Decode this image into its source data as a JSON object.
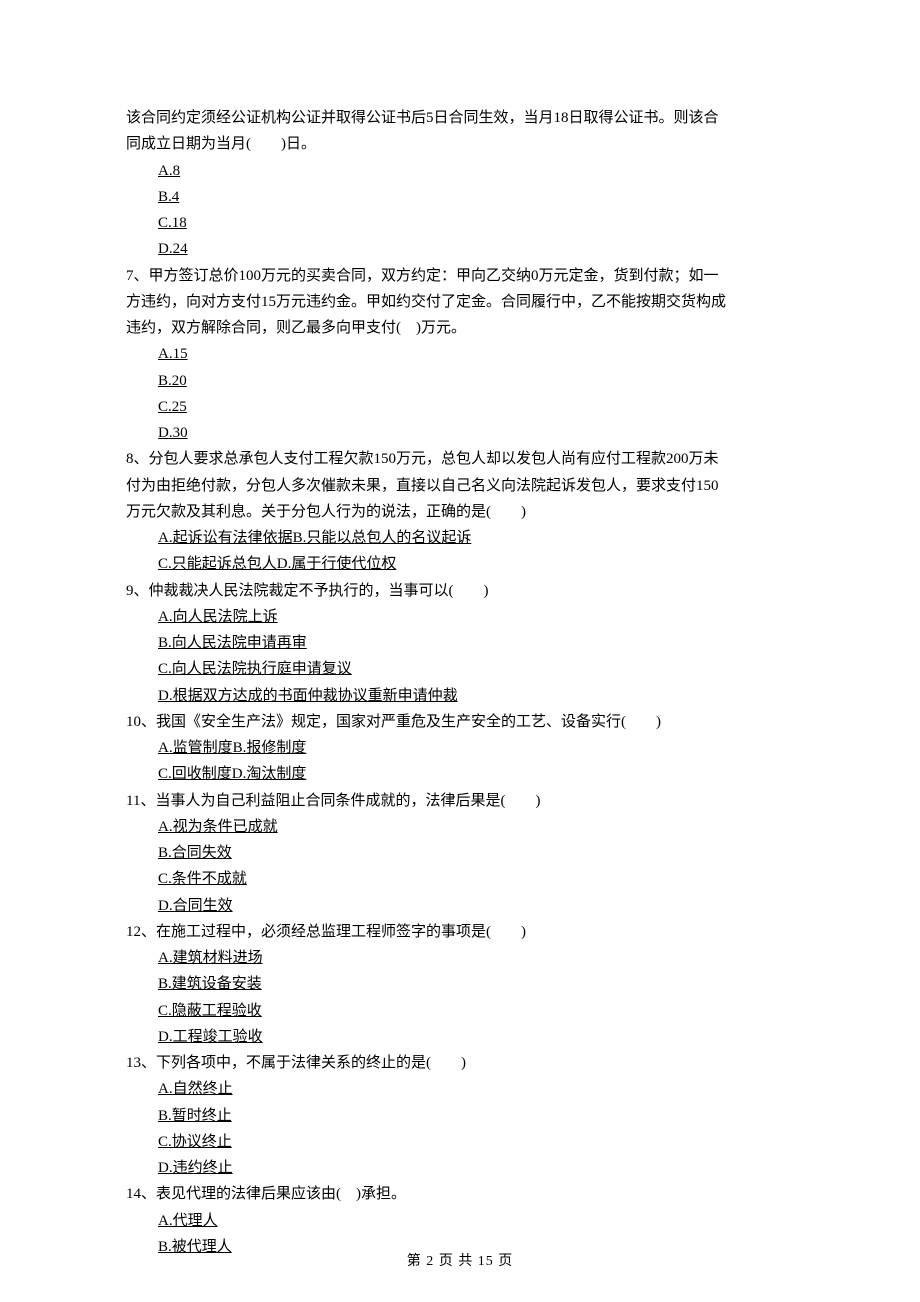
{
  "cont": {
    "l1": "该合同约定须经公证机构公证并取得公证书后5日合同生效，当月18日取得公证书。则该合",
    "l2": "同成立日期为当月(　　)日。",
    "opts": [
      "A.8",
      "B.4",
      "C.18",
      "D.24"
    ]
  },
  "q7": {
    "l1": "7、甲方签订总价100万元的买卖合同，双方约定：甲向乙交纳0万元定金，货到付款；如一",
    "l2": "方违约，向对方支付15万元违约金。甲如约交付了定金。合同履行中，乙不能按期交货构成",
    "l3": "违约，双方解除合同，则乙最多向甲支付(　)万元。",
    "opts": [
      "A.15",
      "B.20",
      "C.25",
      "D.30"
    ]
  },
  "q8": {
    "l1": "8、分包人要求总承包人支付工程欠款150万元，总包人却以发包人尚有应付工程款200万未",
    "l2": "付为由拒绝付款，分包人多次催款未果，直接以自己名义向法院起诉发包人，要求支付150",
    "l3": "万元欠款及其利息。关于分包人行为的说法，正确的是(　　)",
    "opts": [
      "A.起诉讼有法律依据B.只能以总包人的名议起诉",
      "C.只能起诉总包人D.属于行使代位权"
    ]
  },
  "q9": {
    "stem": "9、仲裁裁决人民法院裁定不予执行的，当事可以(　　)",
    "opts": [
      "A.向人民法院上诉",
      "B.向人民法院申请再审",
      "C.向人民法院执行庭申请复议",
      "D.根据双方达成的书面仲裁协议重新申请仲裁"
    ]
  },
  "q10": {
    "stem": "10、我国《安全生产法》规定，国家对严重危及生产安全的工艺、设备实行(　　)",
    "opts": [
      "A.监管制度B.报修制度",
      "C.回收制度D.淘汰制度"
    ]
  },
  "q11": {
    "stem": "11、当事人为自己利益阻止合同条件成就的，法律后果是(　　)",
    "opts": [
      "A.视为条件已成就",
      "B.合同失效",
      "C.条件不成就",
      "D.合同生效"
    ]
  },
  "q12": {
    "stem": "12、在施工过程中，必须经总监理工程师签字的事项是(　　)",
    "opts": [
      "A.建筑材料进场",
      "B.建筑设备安装",
      "C.隐蔽工程验收",
      "D.工程竣工验收"
    ]
  },
  "q13": {
    "stem": "13、下列各项中，不属于法律关系的终止的是(　　)",
    "opts": [
      "A.自然终止",
      "B.暂时终止",
      "C.协议终止",
      "D.违约终止"
    ]
  },
  "q14": {
    "stem": "14、表见代理的法律后果应该由(　)承担。",
    "opts": [
      "A.代理人",
      "B.被代理人"
    ]
  },
  "page_num": "第 2 页 共 15 页"
}
